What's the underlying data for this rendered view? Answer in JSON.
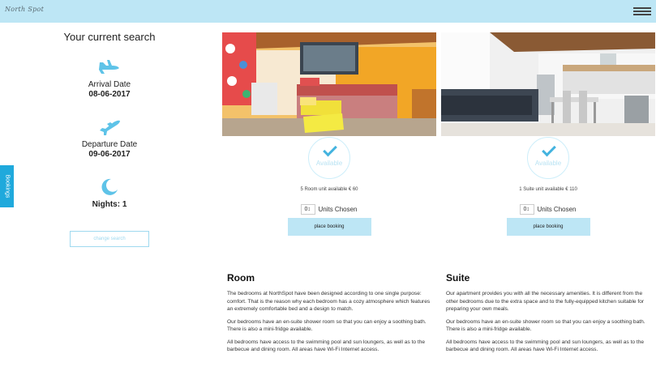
{
  "header": {
    "logo": "North Spot",
    "menu_icon": "hamburger-menu-icon",
    "background": "#bde6f5"
  },
  "booking_tab": {
    "label": "Bookings",
    "color": "#1fa9dc"
  },
  "search": {
    "title": "Your current search",
    "arrival_label": "Arrival Date",
    "arrival_value": "08-06-2017",
    "departure_label": "Departure Date",
    "departure_value": "09-06-2017",
    "nights_label": "Nights: 1",
    "change_button": "change search"
  },
  "rooms": [
    {
      "status": "Available",
      "availability": "5 Room unit available € 60",
      "units_value": "0",
      "units_label": "Units Chosen",
      "button": "place booking",
      "title": "Room",
      "paragraphs": [
        "The bedrooms at NorthSpot have been designed according to one single purpose: comfort. That is the reason why each bedroom has a cozy atmosphere which features an extremely comfortable bed and a design to match.",
        "Our bedrooms have an en-suite shower room so that you can enjoy a soothing bath. There is also a mini-fridge available.",
        "All bedrooms have access to the swimming pool and sun loungers, as well as to the barbecue and dining room. All areas have Wi-Fi Internet access."
      ]
    },
    {
      "status": "Available",
      "availability": "1 Suite unit available € 110",
      "units_value": "0",
      "units_label": "Units Chosen",
      "button": "place booking",
      "title": "Suite",
      "paragraphs": [
        "Our apartment provides you with all the necessary amenities. It is different from the other bedrooms due to the extra space and to the fully-equipped kitchen suitable for preparing your own meals.",
        "Our bedrooms have an en-suite shower room so that you can enjoy a soothing bath. There is also a mini-fridge available.",
        "All bedrooms have access to the swimming pool and sun loungers, as well as to the barbecue and dining room. All areas have Wi-Fi Internet access."
      ]
    }
  ],
  "colors": {
    "accent": "#1fa9dc",
    "icon": "#5ec3e8",
    "check": "#44b3df"
  }
}
